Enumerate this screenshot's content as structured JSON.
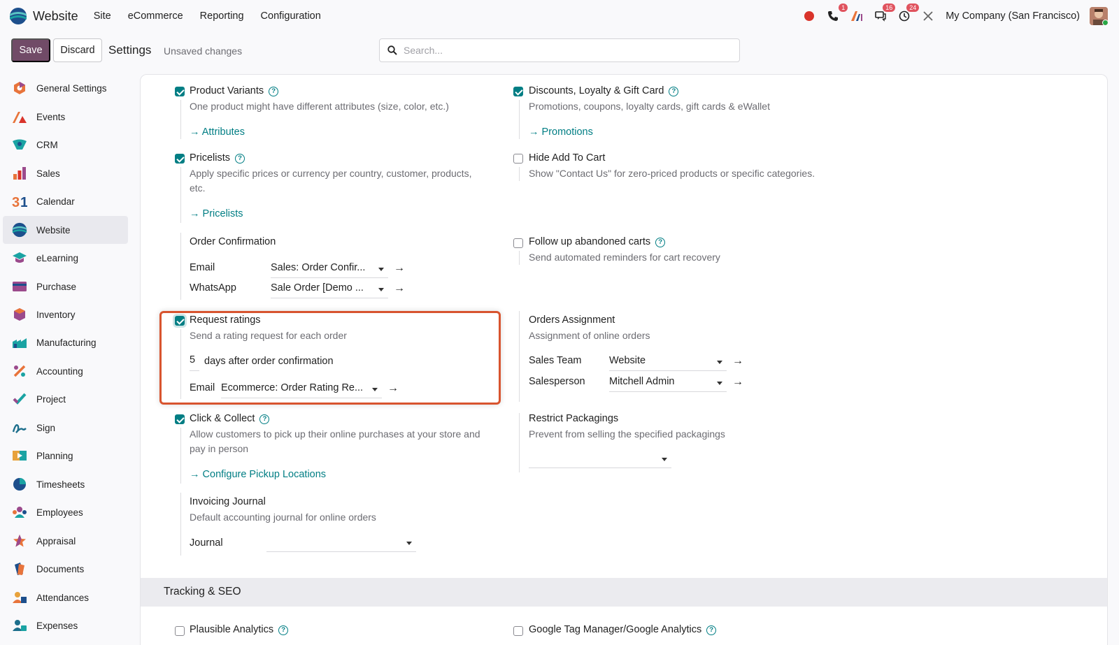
{
  "app": {
    "name": "Website",
    "menu": [
      "Site",
      "eCommerce",
      "Reporting",
      "Configuration"
    ],
    "badges": {
      "phone": "1",
      "chat": "16",
      "activity": "24"
    },
    "company": "My Company (San Francisco)"
  },
  "control": {
    "save_label": "Save",
    "discard_label": "Discard",
    "breadcrumb": "Settings",
    "status": "Unsaved changes",
    "search_placeholder": "Search..."
  },
  "sidebar": {
    "items": [
      {
        "label": "General Settings",
        "icon": "general-settings-icon",
        "color": "#e8743b"
      },
      {
        "label": "Events",
        "icon": "events-icon",
        "color": "#e8743b"
      },
      {
        "label": "CRM",
        "icon": "crm-icon",
        "color": "#1aa3a3"
      },
      {
        "label": "Sales",
        "icon": "sales-icon",
        "color": "#e8743b"
      },
      {
        "label": "Calendar",
        "icon": "calendar-icon",
        "color": "#e8743b"
      },
      {
        "label": "Website",
        "icon": "website-icon",
        "color": "#1aa3a3"
      },
      {
        "label": "eLearning",
        "icon": "elearning-icon",
        "color": "#1aa3a3"
      },
      {
        "label": "Purchase",
        "icon": "purchase-icon",
        "color": "#9b4a8c"
      },
      {
        "label": "Inventory",
        "icon": "inventory-icon",
        "color": "#e8743b"
      },
      {
        "label": "Manufacturing",
        "icon": "manufacturing-icon",
        "color": "#1aa3a3"
      },
      {
        "label": "Accounting",
        "icon": "accounting-icon",
        "color": "#e8743b"
      },
      {
        "label": "Project",
        "icon": "project-icon",
        "color": "#1aa3a3"
      },
      {
        "label": "Sign",
        "icon": "sign-icon",
        "color": "#1d6f8c"
      },
      {
        "label": "Planning",
        "icon": "planning-icon",
        "color": "#1aa3a3"
      },
      {
        "label": "Timesheets",
        "icon": "timesheets-icon",
        "color": "#1d4f8c"
      },
      {
        "label": "Employees",
        "icon": "employees-icon",
        "color": "#9b4a8c"
      },
      {
        "label": "Appraisal",
        "icon": "appraisal-icon",
        "color": "#e8743b"
      },
      {
        "label": "Documents",
        "icon": "documents-icon",
        "color": "#e8743b"
      },
      {
        "label": "Attendances",
        "icon": "attendances-icon",
        "color": "#e8a23b"
      },
      {
        "label": "Expenses",
        "icon": "expenses-icon",
        "color": "#1d6f8c"
      }
    ],
    "active": "Website"
  },
  "settings": {
    "product_variants": {
      "title": "Product Variants",
      "desc": "One product might have different attributes (size, color, etc.)",
      "link": "Attributes",
      "checked": true
    },
    "discounts": {
      "title": "Discounts, Loyalty & Gift Card",
      "desc": "Promotions, coupons, loyalty cards, gift cards & eWallet",
      "link": "Promotions",
      "checked": true
    },
    "pricelists": {
      "title": "Pricelists",
      "desc": "Apply specific prices or currency per country, customer, products, etc.",
      "link": "Pricelists",
      "checked": true
    },
    "hide_add_to_cart": {
      "title": "Hide Add To Cart",
      "desc": "Show \"Contact Us\" for zero-priced products or specific categories.",
      "checked": false
    },
    "order_confirmation": {
      "title": "Order Confirmation",
      "email_label": "Email",
      "email_value": "Sales: Order Confir...",
      "whatsapp_label": "WhatsApp",
      "whatsapp_value": "Sale Order [Demo ..."
    },
    "follow_up": {
      "title": "Follow up abandoned carts",
      "desc": "Send automated reminders for cart recovery",
      "checked": false
    },
    "request_ratings": {
      "title": "Request ratings",
      "desc": "Send a rating request for each order",
      "days": "5",
      "days_label": "days after order confirmation",
      "email_label": "Email",
      "email_value": "Ecommerce: Order Rating Re...",
      "checked": true
    },
    "orders_assignment": {
      "title": "Orders Assignment",
      "desc": "Assignment of online orders",
      "team_label": "Sales Team",
      "team_value": "Website",
      "person_label": "Salesperson",
      "person_value": "Mitchell Admin"
    },
    "click_collect": {
      "title": "Click & Collect",
      "desc": "Allow customers to pick up their online purchases at your store and pay in person",
      "link": "Configure Pickup Locations",
      "checked": true
    },
    "restrict_packagings": {
      "title": "Restrict Packagings",
      "desc": "Prevent from selling the specified packagings"
    },
    "invoicing_journal": {
      "title": "Invoicing Journal",
      "desc": "Default accounting journal for online orders",
      "journal_label": "Journal"
    },
    "tracking_section": "Tracking & SEO",
    "plausible": {
      "title": "Plausible Analytics",
      "checked": false
    },
    "gtm": {
      "title": "Google Tag Manager/Google Analytics",
      "checked": false
    }
  },
  "colors": {
    "accent": "#017e84",
    "primary": "#714b67",
    "highlight": "#d8542f"
  }
}
